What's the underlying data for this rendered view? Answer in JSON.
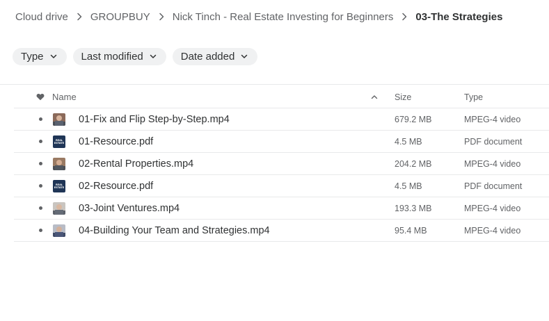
{
  "breadcrumb": {
    "items": [
      {
        "label": "Cloud drive"
      },
      {
        "label": "GROUPBUY"
      },
      {
        "label": "Nick Tinch - Real Estate Investing for Beginners"
      },
      {
        "label": "03-The Strategies"
      }
    ]
  },
  "filters": {
    "type_label": "Type",
    "last_modified_label": "Last modified",
    "date_added_label": "Date added"
  },
  "table": {
    "headers": {
      "name": "Name",
      "size": "Size",
      "type": "Type"
    },
    "sort": {
      "column": "Name",
      "direction": "ascending"
    },
    "rows": [
      {
        "name": "01-Fix and Flip Step-by-Step.mp4",
        "size": "679.2 MB",
        "type": "MPEG-4 video",
        "thumb": "video-thumbnail"
      },
      {
        "name": "01-Resource.pdf",
        "size": "4.5 MB",
        "type": "PDF document",
        "thumb": "pdf-thumbnail"
      },
      {
        "name": "02-Rental Properties.mp4",
        "size": "204.2 MB",
        "type": "MPEG-4 video",
        "thumb": "video-thumbnail"
      },
      {
        "name": "02-Resource.pdf",
        "size": "4.5 MB",
        "type": "PDF document",
        "thumb": "pdf-thumbnail"
      },
      {
        "name": "03-Joint Ventures.mp4",
        "size": "193.3 MB",
        "type": "MPEG-4 video",
        "thumb": "video-thumbnail"
      },
      {
        "name": "04-Building Your Team and Strategies.mp4",
        "size": "95.4 MB",
        "type": "MPEG-4 video",
        "thumb": "video-thumbnail"
      }
    ],
    "pdf_thumb_text": [
      "REAL",
      "ESTATE"
    ]
  },
  "icons": {
    "breadcrumb_separator": "chevron-right-icon",
    "filter_dropdown": "chevron-down-icon",
    "favourite_header": "heart-icon",
    "sort_indicator": "chevron-up-icon",
    "row_marker": "dot-icon"
  },
  "colors": {
    "text_primary": "#303233",
    "text_secondary": "#616366",
    "chip_background": "#f0f1f2",
    "divider": "#e8e9ea",
    "pdf_thumb": "#1f3556"
  }
}
